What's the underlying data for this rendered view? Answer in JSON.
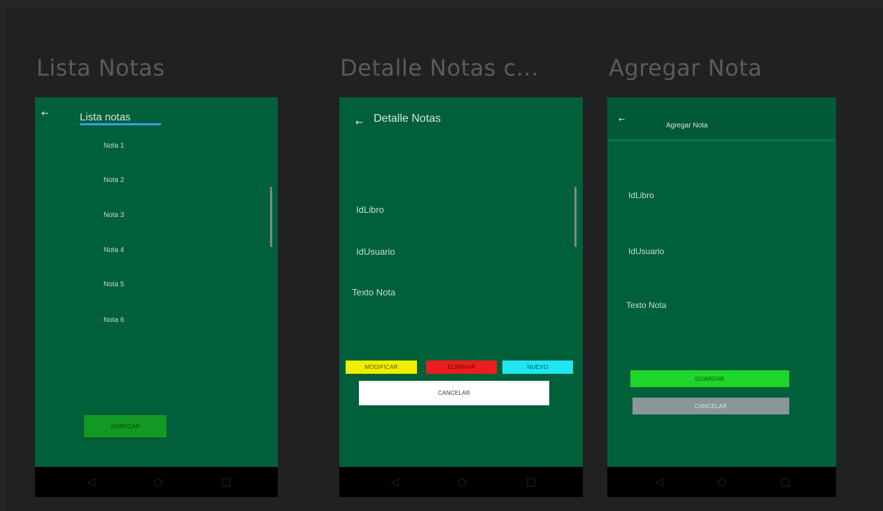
{
  "screens": {
    "lista": {
      "title": "Lista Notas",
      "toolbar_title": "Lista notas",
      "items": [
        "Nota 1",
        "Nota 2",
        "Nota 3",
        "Nota 4",
        "Nota 5",
        "Nota 6"
      ],
      "add_button": "AGREGAR"
    },
    "detalle": {
      "title": "Detalle Notas c...",
      "toolbar_title": "Detalle Notas",
      "fields": [
        "IdLibro",
        "IdUsuario",
        "Texto Nota"
      ],
      "buttons": {
        "modificar": "MODIFICAR",
        "eliminar": "ELIMINAR",
        "nuevo": "NUEVO",
        "cancelar": "CANCELAR"
      }
    },
    "agregar": {
      "title": "Agregar Nota",
      "toolbar_title": "Agregar Nota",
      "fields": [
        "IdLibro",
        "IdUsuario",
        "Texto Nota"
      ],
      "buttons": {
        "guardar": "GUARDAR",
        "cancelar": "CANCELAR"
      }
    }
  },
  "colors": {
    "background": "#212121",
    "screen": "#00603a",
    "modificar": "#f2ee00",
    "eliminar": "#ee1c1c",
    "nuevo": "#1fe6f2",
    "cancelar_detalle": "#ffffff",
    "guardar": "#1fd62a",
    "cancelar_agregar": "#8c9699",
    "agregar": "#129a25"
  },
  "icons": {
    "back": "arrow-left-icon",
    "nav": [
      "nav-back-icon",
      "nav-home-icon",
      "nav-recents-icon"
    ]
  }
}
